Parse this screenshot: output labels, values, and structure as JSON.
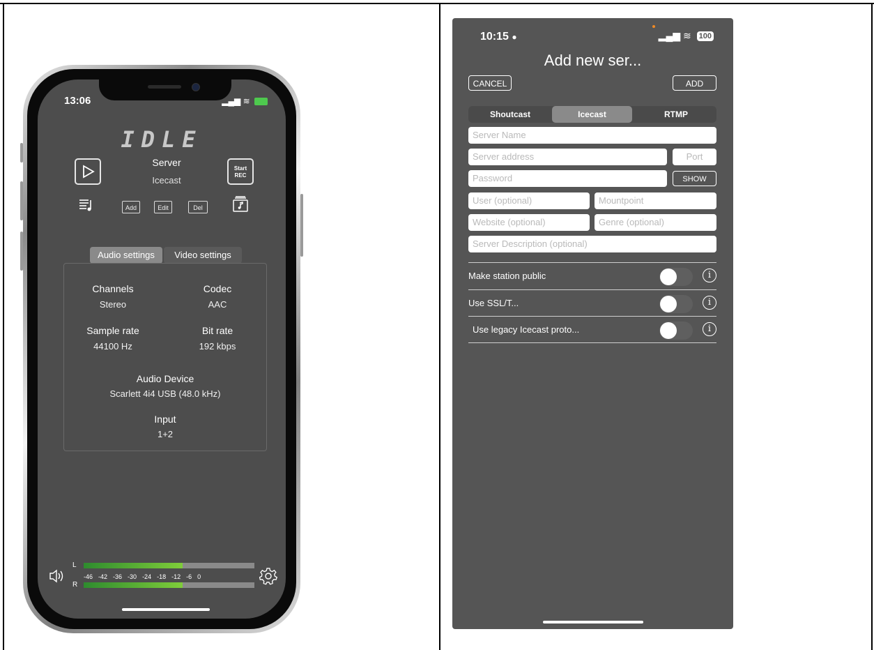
{
  "left": {
    "status": {
      "time": "13:06"
    },
    "idle_display": "IDLE",
    "server": {
      "label": "Server",
      "value": "Icecast"
    },
    "rec_button": {
      "line1": "Start",
      "line2": "REC"
    },
    "buttons": {
      "add": "Add",
      "edit": "Edit",
      "del": "Del"
    },
    "tabs": {
      "audio": "Audio settings",
      "video": "Video settings"
    },
    "settings": {
      "channels_label": "Channels",
      "channels_value": "Stereo",
      "codec_label": "Codec",
      "codec_value": "AAC",
      "sample_rate_label": "Sample rate",
      "sample_rate_value": "44100 Hz",
      "bit_rate_label": "Bit rate",
      "bit_rate_value": "192 kbps",
      "device_label": "Audio Device",
      "device_value": "Scarlett 4i4 USB (48.0 kHz)",
      "input_label": "Input",
      "input_value": "1+2"
    },
    "meter": {
      "left_label": "L",
      "right_label": "R",
      "scale": [
        "-46",
        "-42",
        "-36",
        "-30",
        "-24",
        "-18",
        "-12",
        "-6",
        "0"
      ],
      "left_level": 0.58,
      "right_level": 0.58
    }
  },
  "right": {
    "status": {
      "time": "10:15",
      "battery": "100"
    },
    "title": "Add new ser...",
    "cancel_label": "CANCEL",
    "add_label": "ADD",
    "tabs": {
      "shoutcast": "Shoutcast",
      "icecast": "Icecast",
      "rtmp": "RTMP",
      "selected": "Icecast"
    },
    "fields": {
      "server_name": "Server Name",
      "server_address": "Server address",
      "port": "Port",
      "password": "Password",
      "show": "SHOW",
      "user": "User (optional)",
      "mountpoint": "Mountpoint",
      "website": "Website (optional)",
      "genre": "Genre (optional)",
      "description": "Server Description (optional)"
    },
    "toggles": {
      "public": "Make station public",
      "ssl": "Use SSL/T...",
      "legacy": "Use legacy Icecast proto..."
    }
  },
  "colors": {
    "accent_green": "#4ec94e",
    "panel_gray": "#555555",
    "segment_selected": "#8a8a8a"
  }
}
